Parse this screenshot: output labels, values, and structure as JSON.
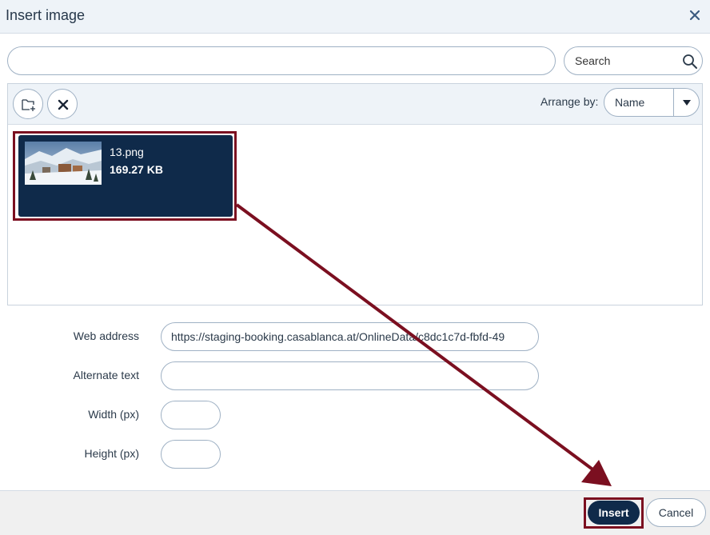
{
  "dialog": {
    "title": "Insert image",
    "close_icon": "close-icon"
  },
  "search": {
    "path_value": "",
    "placeholder": "Search",
    "icon": "search-icon"
  },
  "toolbar": {
    "new_folder_icon": "folder-plus-icon",
    "delete_icon": "close-icon",
    "arrange_label": "Arrange by:",
    "arrange_value": "Name",
    "arrange_icon": "caret-down-icon"
  },
  "files": [
    {
      "name": "13.png",
      "size": "169.27 KB",
      "selected": true
    }
  ],
  "form": {
    "web_address_label": "Web address",
    "web_address_value": "https://staging-booking.casablanca.at/OnlineData/c8dc1c7d-fbfd-49",
    "alt_text_label": "Alternate text",
    "alt_text_value": "",
    "width_label": "Width (px)",
    "width_value": "",
    "height_label": "Height (px)",
    "height_value": ""
  },
  "footer": {
    "insert_label": "Insert",
    "cancel_label": "Cancel"
  },
  "colors": {
    "accent": "#0f2a4a",
    "highlight": "#7b0f20",
    "header_bg": "#eef3f8"
  }
}
